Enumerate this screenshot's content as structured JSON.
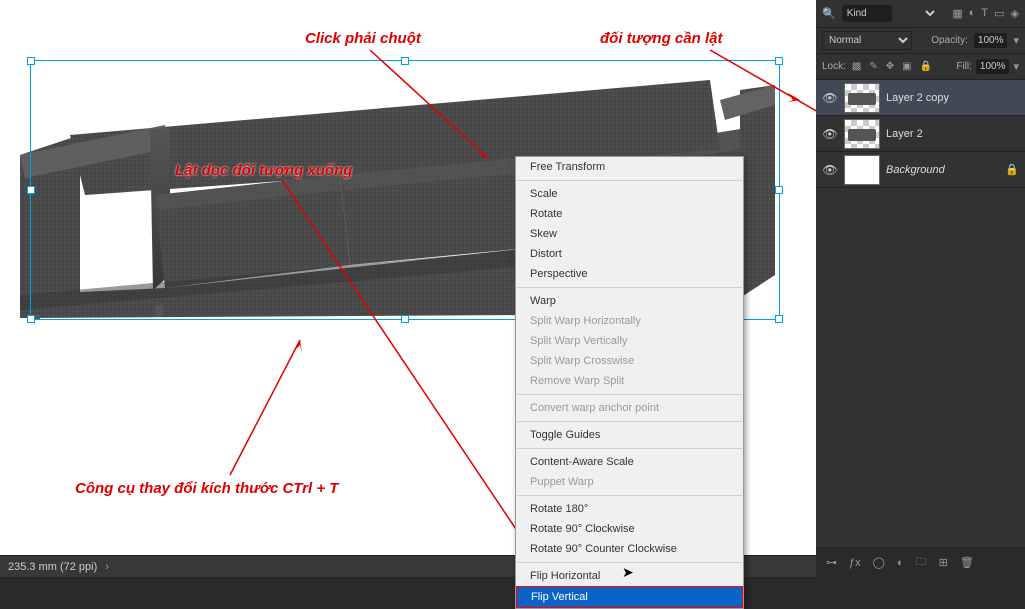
{
  "annotations": {
    "a1": "Click phải chuột",
    "a2": "đối tượng cần lật",
    "a3": "Lật dọc đối tượng xuống",
    "a4": "Công cụ thay đổi kích thước CTrl + T"
  },
  "context_menu": {
    "free_transform": "Free Transform",
    "scale": "Scale",
    "rotate": "Rotate",
    "skew": "Skew",
    "distort": "Distort",
    "perspective": "Perspective",
    "warp": "Warp",
    "split_h": "Split Warp Horizontally",
    "split_v": "Split Warp Vertically",
    "split_c": "Split Warp Crosswise",
    "remove_split": "Remove Warp Split",
    "convert_anchor": "Convert warp anchor point",
    "toggle_guides": "Toggle Guides",
    "content_aware": "Content-Aware Scale",
    "puppet": "Puppet Warp",
    "r180": "Rotate 180°",
    "r90cw": "Rotate 90° Clockwise",
    "r90ccw": "Rotate 90° Counter Clockwise",
    "flip_h": "Flip Horizontal",
    "flip_v": "Flip Vertical"
  },
  "layers_panel": {
    "search_placeholder": "Kind",
    "blend_mode": "Normal",
    "opacity_label": "Opacity:",
    "opacity_value": "100%",
    "lock_label": "Lock:",
    "fill_label": "Fill:",
    "fill_value": "100%",
    "layer1": "Layer 2 copy",
    "layer2": "Layer 2",
    "layer3": "Background"
  },
  "status_bar": {
    "doc_info": "235.3 mm (72 ppi)"
  }
}
